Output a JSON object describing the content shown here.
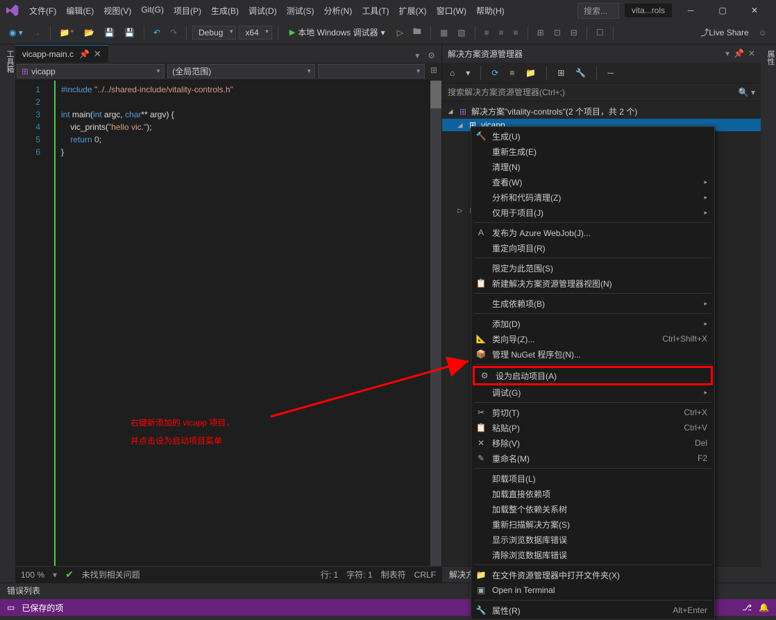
{
  "menubar": {
    "items": [
      "文件(F)",
      "编辑(E)",
      "视图(V)",
      "Git(G)",
      "项目(P)",
      "生成(B)",
      "调试(D)",
      "测试(S)",
      "分析(N)",
      "工具(T)",
      "扩展(X)",
      "窗口(W)",
      "帮助(H)"
    ],
    "search_placeholder": "搜索... ",
    "title": "vita...rols"
  },
  "toolbar": {
    "config": "Debug",
    "platform": "x64",
    "debug_target": "本地 Windows 调试器",
    "live_share": "Live Share"
  },
  "left_gutter": "工具箱",
  "right_gutter": "属性",
  "editor": {
    "tab_name": "vicapp-main.c",
    "nav_left": "vicapp",
    "nav_right": "(全局范围)",
    "lines": [
      "1",
      "2",
      "3",
      "4",
      "5",
      "6"
    ],
    "code_l1_a": "#include ",
    "code_l1_b": "\"../../shared-include/vitality-controls.h\"",
    "code_l3_a": "int",
    "code_l3_b": " main(",
    "code_l3_c": "int",
    "code_l3_d": " argc, ",
    "code_l3_e": "char",
    "code_l3_f": "** argv) {",
    "code_l4_a": "    vic_prints(",
    "code_l4_b": "\"hello vic.\"",
    "code_l4_c": ");",
    "code_l5_a": "    ",
    "code_l5_b": "return",
    "code_l5_c": " ",
    "code_l5_d": "0",
    "code_l5_e": ";",
    "code_l6": "}",
    "status_zoom": "100 %",
    "status_issue": "未找到相关问题",
    "status_line": "行: 1",
    "status_col": "字符: 1",
    "status_tab": "制表符",
    "status_eol": "CRLF"
  },
  "sol": {
    "title": "解决方案资源管理器",
    "search_placeholder": "搜索解决方案资源管理器(Ctrl+;)",
    "root": "解决方案\"vitality-controls\"(2 个项目，共 2 个)",
    "proj1": "vicapp",
    "tabs": [
      "解决方案"
    ]
  },
  "ctx": {
    "items": [
      {
        "label": "生成(U)",
        "icon": "🔨"
      },
      {
        "label": "重新生成(E)"
      },
      {
        "label": "清理(N)"
      },
      {
        "label": "查看(W)",
        "sub": true
      },
      {
        "label": "分析和代码清理(Z)",
        "sub": true
      },
      {
        "label": "仅用于项目(J)",
        "sub": true
      },
      {
        "sep": true
      },
      {
        "label": "发布为 Azure WebJob(J)...",
        "icon": "A"
      },
      {
        "label": "重定向项目(R)"
      },
      {
        "sep": true
      },
      {
        "label": "限定为此范围(S)"
      },
      {
        "label": "新建解决方案资源管理器视图(N)",
        "icon": "📋"
      },
      {
        "sep": true
      },
      {
        "label": "生成依赖项(B)",
        "sub": true
      },
      {
        "sep": true
      },
      {
        "label": "添加(D)",
        "sub": true
      },
      {
        "label": "类向导(Z)...",
        "icon": "📐",
        "shortcut": "Ctrl+Shift+X"
      },
      {
        "label": "管理 NuGet 程序包(N)...",
        "icon": "📦"
      },
      {
        "sep": true
      },
      {
        "label": "设为启动项目(A)",
        "icon": "⚙",
        "highlight": true
      },
      {
        "label": "调试(G)",
        "sub": true
      },
      {
        "sep": true
      },
      {
        "label": "剪切(T)",
        "icon": "✂",
        "shortcut": "Ctrl+X"
      },
      {
        "label": "粘贴(P)",
        "icon": "📋",
        "shortcut": "Ctrl+V"
      },
      {
        "label": "移除(V)",
        "icon": "✕",
        "shortcut": "Del"
      },
      {
        "label": "重命名(M)",
        "icon": "✎",
        "shortcut": "F2"
      },
      {
        "sep": true
      },
      {
        "label": "卸载项目(L)"
      },
      {
        "label": "加载直接依赖项"
      },
      {
        "label": "加载整个依赖关系树"
      },
      {
        "label": "重新扫描解决方案(S)"
      },
      {
        "label": "显示浏览数据库错误"
      },
      {
        "label": "清除浏览数据库错误"
      },
      {
        "sep": true
      },
      {
        "label": "在文件资源管理器中打开文件夹(X)",
        "icon": "📁"
      },
      {
        "label": "Open in Terminal",
        "icon": "▣"
      },
      {
        "sep": true
      },
      {
        "label": "属性(R)",
        "icon": "🔧",
        "shortcut": "Alt+Enter"
      }
    ]
  },
  "annotation": {
    "line1": "右键新添加的 vicapp 项目，",
    "line2": "并点击设为启动项目菜单"
  },
  "bottom": {
    "error_list": "错误列表",
    "status": "已保存的项"
  }
}
